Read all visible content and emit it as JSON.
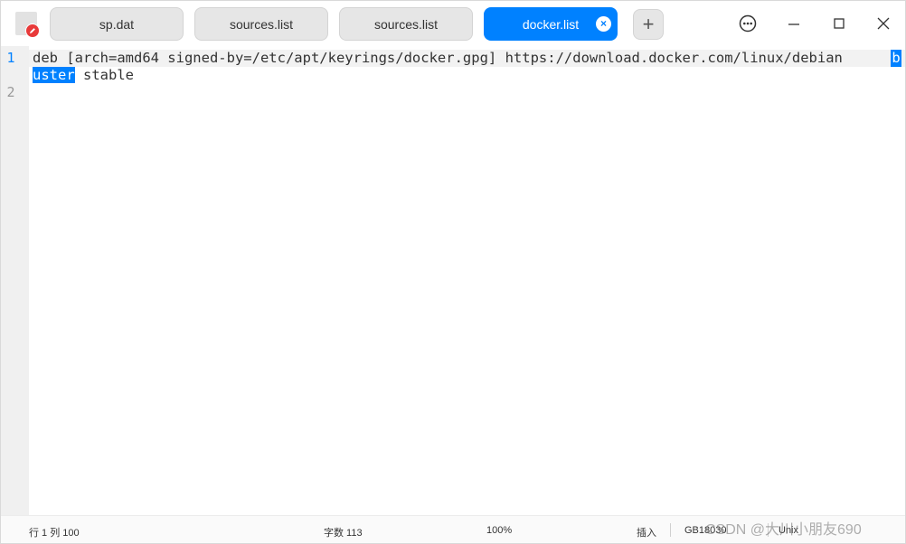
{
  "tabs": [
    {
      "label": "sp.dat"
    },
    {
      "label": "sources.list"
    },
    {
      "label": "sources.list"
    },
    {
      "label": "docker.list"
    }
  ],
  "add_tab_label": "+",
  "editor": {
    "line_numbers": [
      "1",
      "2"
    ],
    "line1": "deb [arch=amd64 signed-by=/etc/apt/keyrings/docker.gpg] https://download.docker.com/linux/debian",
    "line1_selected_tail": "b",
    "line1_wrap_selected": "uster",
    "line1_wrap_rest": " stable"
  },
  "status": {
    "position": "行 1  列 100",
    "char_count": "字数 113",
    "zoom": "100%",
    "mode": "插入",
    "encoding": "GB18030",
    "line_ending": "Unix"
  },
  "watermark": "CSDN @大川小朋友690",
  "colors": {
    "accent": "#0081ff",
    "close_button": "#e83a3a"
  }
}
